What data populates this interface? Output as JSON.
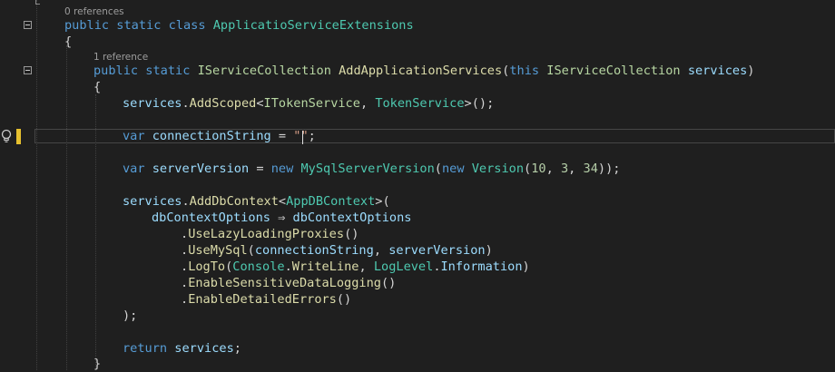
{
  "editor": {
    "codelens": {
      "class_refs": "0 references",
      "method_refs": "1 reference"
    },
    "lines": {
      "class_decl": [
        {
          "t": "public",
          "c": "kw"
        },
        {
          "t": " "
        },
        {
          "t": "static",
          "c": "kw"
        },
        {
          "t": " "
        },
        {
          "t": "class",
          "c": "kw"
        },
        {
          "t": " "
        },
        {
          "t": "ApplicatioServiceExtensions",
          "c": "ty"
        }
      ],
      "class_open": [
        {
          "t": "{"
        }
      ],
      "method_decl": [
        {
          "t": "public",
          "c": "kw"
        },
        {
          "t": " "
        },
        {
          "t": "static",
          "c": "kw"
        },
        {
          "t": " "
        },
        {
          "t": "IServiceCollection",
          "c": "iface"
        },
        {
          "t": " "
        },
        {
          "t": "AddApplicationServices",
          "c": "fn"
        },
        {
          "t": "("
        },
        {
          "t": "this",
          "c": "kw"
        },
        {
          "t": " "
        },
        {
          "t": "IServiceCollection",
          "c": "iface"
        },
        {
          "t": " "
        },
        {
          "t": "services",
          "c": "vr"
        },
        {
          "t": ")"
        }
      ],
      "method_open": [
        {
          "t": "{"
        }
      ],
      "add_scoped": [
        {
          "t": "services",
          "c": "vr"
        },
        {
          "t": "."
        },
        {
          "t": "AddScoped",
          "c": "fn"
        },
        {
          "t": "<"
        },
        {
          "t": "ITokenService",
          "c": "iface"
        },
        {
          "t": ", "
        },
        {
          "t": "TokenService",
          "c": "ty"
        },
        {
          "t": ">();"
        }
      ],
      "conn_string": [
        {
          "t": "var",
          "c": "kw"
        },
        {
          "t": " "
        },
        {
          "t": "connectionString",
          "c": "vr"
        },
        {
          "t": " = "
        },
        {
          "t": "\"\"",
          "c": "str"
        },
        {
          "t": ";"
        }
      ],
      "server_version": [
        {
          "t": "var",
          "c": "kw"
        },
        {
          "t": " "
        },
        {
          "t": "serverVersion",
          "c": "vr"
        },
        {
          "t": " = "
        },
        {
          "t": "new",
          "c": "kw"
        },
        {
          "t": " "
        },
        {
          "t": "MySqlServerVersion",
          "c": "ty"
        },
        {
          "t": "("
        },
        {
          "t": "new",
          "c": "kw"
        },
        {
          "t": " "
        },
        {
          "t": "Version",
          "c": "ty"
        },
        {
          "t": "("
        },
        {
          "t": "10",
          "c": "num"
        },
        {
          "t": ", "
        },
        {
          "t": "3",
          "c": "num"
        },
        {
          "t": ", "
        },
        {
          "t": "34",
          "c": "num"
        },
        {
          "t": "));"
        }
      ],
      "add_db_context": [
        {
          "t": "services",
          "c": "vr"
        },
        {
          "t": "."
        },
        {
          "t": "AddDbContext",
          "c": "fn"
        },
        {
          "t": "<"
        },
        {
          "t": "AppDBContext",
          "c": "ty"
        },
        {
          "t": ">("
        }
      ],
      "lambda": [
        {
          "t": "dbContextOptions",
          "c": "vr"
        },
        {
          "t": " ⇒ "
        },
        {
          "t": "dbContextOptions",
          "c": "vr"
        }
      ],
      "lazy_loading": [
        {
          "t": "."
        },
        {
          "t": "UseLazyLoadingProxies",
          "c": "fn"
        },
        {
          "t": "()"
        }
      ],
      "use_mysql": [
        {
          "t": "."
        },
        {
          "t": "UseMySql",
          "c": "fn"
        },
        {
          "t": "("
        },
        {
          "t": "connectionString",
          "c": "vr"
        },
        {
          "t": ", "
        },
        {
          "t": "serverVersion",
          "c": "vr"
        },
        {
          "t": ")"
        }
      ],
      "log_to": [
        {
          "t": "."
        },
        {
          "t": "LogTo",
          "c": "fn"
        },
        {
          "t": "("
        },
        {
          "t": "Console",
          "c": "ty"
        },
        {
          "t": "."
        },
        {
          "t": "WriteLine",
          "c": "fn"
        },
        {
          "t": ", "
        },
        {
          "t": "LogLevel",
          "c": "ty"
        },
        {
          "t": "."
        },
        {
          "t": "Information",
          "c": "vr"
        },
        {
          "t": ")"
        }
      ],
      "sensitive_logging": [
        {
          "t": "."
        },
        {
          "t": "EnableSensitiveDataLogging",
          "c": "fn"
        },
        {
          "t": "()"
        }
      ],
      "detailed_errors": [
        {
          "t": "."
        },
        {
          "t": "EnableDetailedErrors",
          "c": "fn"
        },
        {
          "t": "()"
        }
      ],
      "close_call": [
        {
          "t": ");"
        }
      ],
      "return_stmt": [
        {
          "t": "return",
          "c": "kw"
        },
        {
          "t": " "
        },
        {
          "t": "services",
          "c": "vr"
        },
        {
          "t": ";"
        }
      ],
      "method_close": [
        {
          "t": "}"
        }
      ]
    },
    "icons": {
      "lightbulb": "lightbulb-icon",
      "collapse": "collapse-minus-icon"
    },
    "colors": {
      "background": "#1f1f1f",
      "keyword": "#569cd6",
      "type": "#4ec9b0",
      "interface": "#b8d7a3",
      "method": "#dcdcaa",
      "variable": "#9cdcfe",
      "number": "#b5cea8",
      "string": "#d69d85",
      "change_marker": "#e6c02f"
    }
  }
}
